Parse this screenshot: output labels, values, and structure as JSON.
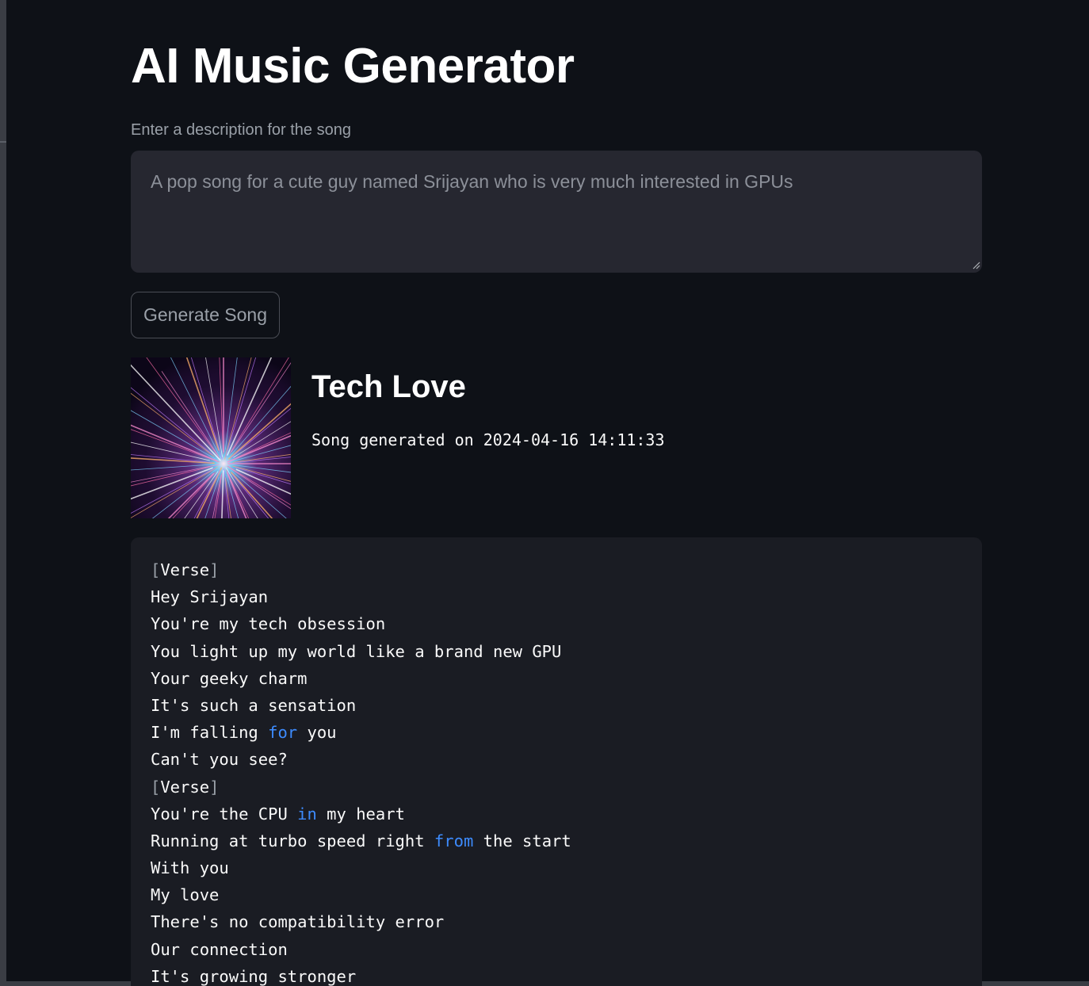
{
  "app": {
    "title": "AI Music Generator"
  },
  "form": {
    "label": "Enter a description for the song",
    "placeholder": "A pop song for a cute guy named Srijayan who is very much interested in GPUs",
    "button_label": "Generate Song"
  },
  "song": {
    "title": "Tech Love",
    "generated_text": "Song generated on 2024-04-16 14:11:33",
    "lyrics": [
      [
        {
          "t": "[",
          "c": "bracket"
        },
        {
          "t": "Verse"
        },
        {
          "t": "]",
          "c": "bracket"
        }
      ],
      [
        {
          "t": "Hey Srijayan"
        }
      ],
      [
        {
          "t": "You're my tech obsession"
        }
      ],
      [
        {
          "t": "You light up my world like a brand new GPU"
        }
      ],
      [
        {
          "t": "Your geeky charm"
        }
      ],
      [
        {
          "t": "It's such a sensation"
        }
      ],
      [
        {
          "t": "I'm falling "
        },
        {
          "t": "for",
          "c": "kw"
        },
        {
          "t": " you"
        }
      ],
      [
        {
          "t": "Can't you see?"
        }
      ],
      [
        {
          "t": "[",
          "c": "bracket"
        },
        {
          "t": "Verse"
        },
        {
          "t": "]",
          "c": "bracket"
        }
      ],
      [
        {
          "t": "You're the CPU "
        },
        {
          "t": "in",
          "c": "kw"
        },
        {
          "t": " my heart"
        }
      ],
      [
        {
          "t": "Running at turbo speed right "
        },
        {
          "t": "from",
          "c": "kw"
        },
        {
          "t": " the start"
        }
      ],
      [
        {
          "t": "With you"
        }
      ],
      [
        {
          "t": "My love"
        }
      ],
      [
        {
          "t": "There's no compatibility error"
        }
      ],
      [
        {
          "t": "Our connection"
        }
      ],
      [
        {
          "t": "It's growing stronger"
        }
      ]
    ]
  },
  "colors": {
    "background": "#0e1117",
    "input_bg": "#262730",
    "code_bg": "#1a1c23",
    "keyword": "#3d8bfd"
  }
}
